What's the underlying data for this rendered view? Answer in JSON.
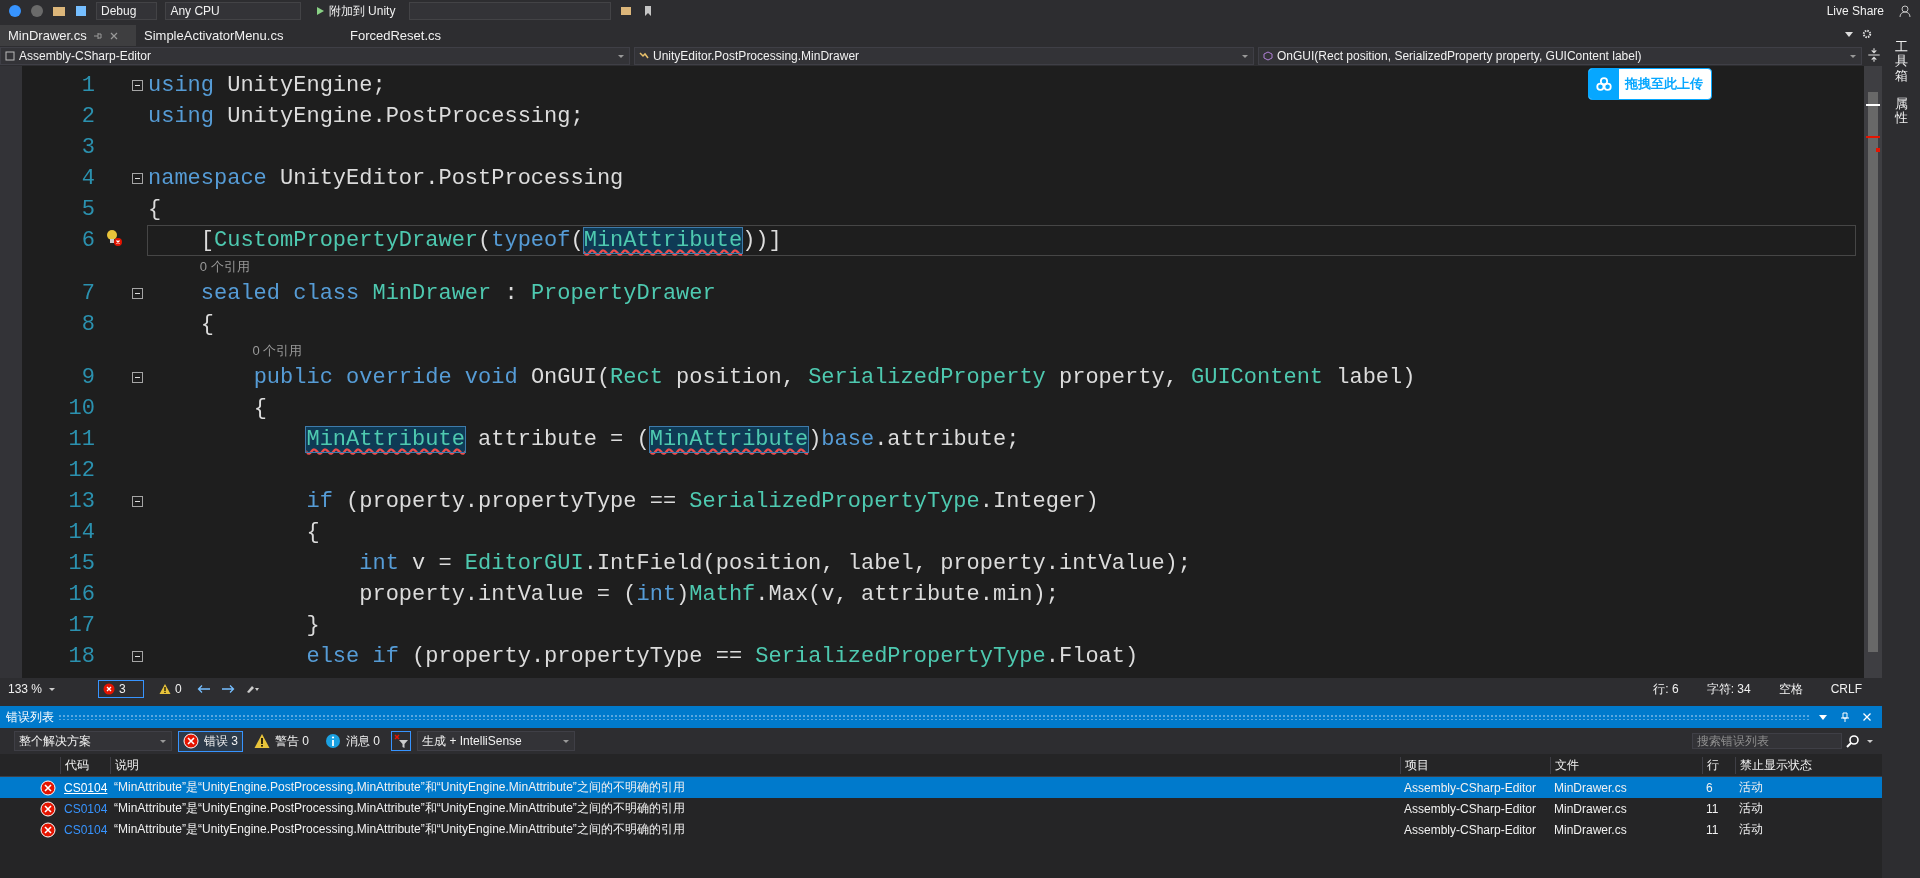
{
  "toolbar": {
    "configuration": "Debug",
    "platform": "Any CPU",
    "run_button": "附加到 Unity",
    "live_share": "Live Share"
  },
  "tabs": [
    {
      "label": "MinDrawer.cs",
      "selected": true
    },
    {
      "label": "SimpleActivatorMenu.cs",
      "selected": false
    },
    {
      "label": "ForcedReset.cs",
      "selected": false
    }
  ],
  "nav_bar": {
    "project": "Assembly-CSharp-Editor",
    "type": "UnityEditor.PostProcessing.MinDrawer",
    "member": "OnGUI(Rect position, SerializedProperty property, GUIContent label)"
  },
  "upload_button": "拖拽至此上传",
  "code_lines": [
    {
      "number": "1",
      "fold": true,
      "quick_action": false,
      "current": false,
      "tokens": [
        {
          "t": "using",
          "kind": "kw"
        },
        {
          "t": " UnityEngine;",
          "kind": "text"
        }
      ]
    },
    {
      "number": "2",
      "fold": false,
      "quick_action": false,
      "current": false,
      "tokens": [
        {
          "t": "using",
          "kind": "kw"
        },
        {
          "t": " UnityEngine.PostProcessing;",
          "kind": "text"
        }
      ]
    },
    {
      "number": "3",
      "fold": false,
      "quick_action": false,
      "current": false
    },
    {
      "number": "4",
      "fold": true,
      "quick_action": false,
      "current": false,
      "tokens": [
        {
          "t": "namespace",
          "kind": "kw"
        },
        {
          "t": " UnityEditor.PostProcessing",
          "kind": "text"
        }
      ]
    },
    {
      "number": "5",
      "fold": false,
      "quick_action": false,
      "current": false,
      "tokens": [
        {
          "t": "{",
          "kind": "text"
        }
      ]
    },
    {
      "number": "6",
      "fold": false,
      "quick_action": true,
      "current": true,
      "tokens": [
        {
          "t": "    [",
          "kind": "text"
        },
        {
          "t": "CustomPropertyDrawer",
          "kind": "type"
        },
        {
          "t": "(",
          "kind": "text"
        },
        {
          "t": "typeof",
          "kind": "kw"
        },
        {
          "t": "(",
          "kind": "text"
        },
        {
          "t": "MinAttribute",
          "kind": "err"
        },
        {
          "t": "))]",
          "kind": "text"
        }
      ]
    },
    {
      "number": "7",
      "fold": true,
      "quick_action": false,
      "current": false,
      "lens": "0 个引用",
      "tokens": [
        {
          "t": "    sealed class ",
          "kind": "kw"
        },
        {
          "t": "MinDrawer",
          "kind": "type"
        },
        {
          "t": " : ",
          "kind": "text"
        },
        {
          "t": "PropertyDrawer",
          "kind": "type"
        }
      ]
    },
    {
      "number": "8",
      "fold": false,
      "quick_action": false,
      "current": false,
      "tokens": [
        {
          "t": "    {",
          "kind": "text"
        }
      ]
    },
    {
      "number": "9",
      "fold": true,
      "quick_action": false,
      "current": false,
      "lens": "0 个引用",
      "tokens": [
        {
          "t": "        public override void",
          "kind": "kw"
        },
        {
          "t": " OnGUI(",
          "kind": "text"
        },
        {
          "t": "Rect",
          "kind": "type"
        },
        {
          "t": " position, ",
          "kind": "text"
        },
        {
          "t": "SerializedProperty",
          "kind": "type"
        },
        {
          "t": " property, ",
          "kind": "text"
        },
        {
          "t": "GUIContent",
          "kind": "type"
        },
        {
          "t": " label)",
          "kind": "text"
        }
      ]
    },
    {
      "number": "10",
      "fold": false,
      "quick_action": false,
      "current": false,
      "tokens": [
        {
          "t": "        {",
          "kind": "text"
        }
      ]
    },
    {
      "number": "11",
      "fold": false,
      "quick_action": false,
      "current": false,
      "tokens": [
        {
          "t": "            MinAttribute",
          "kind": "err"
        },
        {
          "t": " attribute = (",
          "kind": "text"
        },
        {
          "t": "MinAttribute",
          "kind": "err"
        },
        {
          "t": ")",
          "kind": "text"
        },
        {
          "t": "base",
          "kind": "kw"
        },
        {
          "t": ".attribute;",
          "kind": "text"
        }
      ]
    },
    {
      "number": "12",
      "fold": false,
      "quick_action": false,
      "current": false
    },
    {
      "number": "13",
      "fold": true,
      "quick_action": false,
      "current": false,
      "tokens": [
        {
          "t": "            if",
          "kind": "kw"
        },
        {
          "t": " (property.propertyType == ",
          "kind": "text"
        },
        {
          "t": "SerializedPropertyType",
          "kind": "type"
        },
        {
          "t": ".Integer)",
          "kind": "text"
        }
      ]
    },
    {
      "number": "14",
      "fold": false,
      "quick_action": false,
      "current": false,
      "tokens": [
        {
          "t": "            {",
          "kind": "text"
        }
      ]
    },
    {
      "number": "15",
      "fold": false,
      "quick_action": false,
      "current": false,
      "tokens": [
        {
          "t": "                int",
          "kind": "kw"
        },
        {
          "t": " v = ",
          "kind": "text"
        },
        {
          "t": "EditorGUI",
          "kind": "type"
        },
        {
          "t": ".IntField(position, label, property.intValue);",
          "kind": "text"
        }
      ]
    },
    {
      "number": "16",
      "fold": false,
      "quick_action": false,
      "current": false,
      "tokens": [
        {
          "t": "                property.intValue = (",
          "kind": "text"
        },
        {
          "t": "int",
          "kind": "kw"
        },
        {
          "t": ")",
          "kind": "text"
        },
        {
          "t": "Mathf",
          "kind": "type"
        },
        {
          "t": ".Max(v, attribute.min);",
          "kind": "text"
        }
      ]
    },
    {
      "number": "17",
      "fold": false,
      "quick_action": false,
      "current": false,
      "tokens": [
        {
          "t": "            }",
          "kind": "text"
        }
      ]
    },
    {
      "number": "18",
      "fold": true,
      "quick_action": false,
      "current": false,
      "tokens": [
        {
          "t": "            else if",
          "kind": "kw"
        },
        {
          "t": " (property.propertyType == ",
          "kind": "text"
        },
        {
          "t": "SerializedPropertyType",
          "kind": "type"
        },
        {
          "t": ".Float)",
          "kind": "text"
        }
      ]
    }
  ],
  "editor_status": {
    "zoom": "133 %",
    "errors": "3",
    "warnings": "0",
    "line": "行: 6",
    "column": "字符: 34",
    "indent": "空格",
    "line_ending": "CRLF"
  },
  "error_list": {
    "title": "错误列表",
    "scope": "整个解决方案",
    "filters": [
      {
        "kind": "error",
        "label": "错误 3",
        "selected": true
      },
      {
        "kind": "warning",
        "label": "警告 0",
        "selected": false
      },
      {
        "kind": "info",
        "label": "消息 0",
        "selected": false
      }
    ],
    "source": "生成 + IntelliSense",
    "search": {
      "placeholder": "搜索错误列表"
    },
    "columns": [
      "代码",
      "说明",
      "项目",
      "文件",
      "行",
      "禁止显示状态"
    ],
    "rows": [
      {
        "code": "CS0104",
        "description": "“MinAttribute”是“UnityEngine.PostProcessing.MinAttribute”和“UnityEngine.MinAttribute”之间的不明确的引用",
        "project": "Assembly-CSharp-Editor",
        "file": "MinDrawer.cs",
        "line": "6",
        "state": "活动",
        "selected": true
      },
      {
        "code": "CS0104",
        "description": "“MinAttribute”是“UnityEngine.PostProcessing.MinAttribute”和“UnityEngine.MinAttribute”之间的不明确的引用",
        "project": "Assembly-CSharp-Editor",
        "file": "MinDrawer.cs",
        "line": "11",
        "state": "活动",
        "selected": false
      },
      {
        "code": "CS0104",
        "description": "“MinAttribute”是“UnityEngine.PostProcessing.MinAttribute”和“UnityEngine.MinAttribute”之间的不明确的引用",
        "project": "Assembly-CSharp-Editor",
        "file": "MinDrawer.cs",
        "line": "11",
        "state": "活动",
        "selected": false
      }
    ]
  },
  "side_panel": [
    "工具箱",
    "属性"
  ]
}
